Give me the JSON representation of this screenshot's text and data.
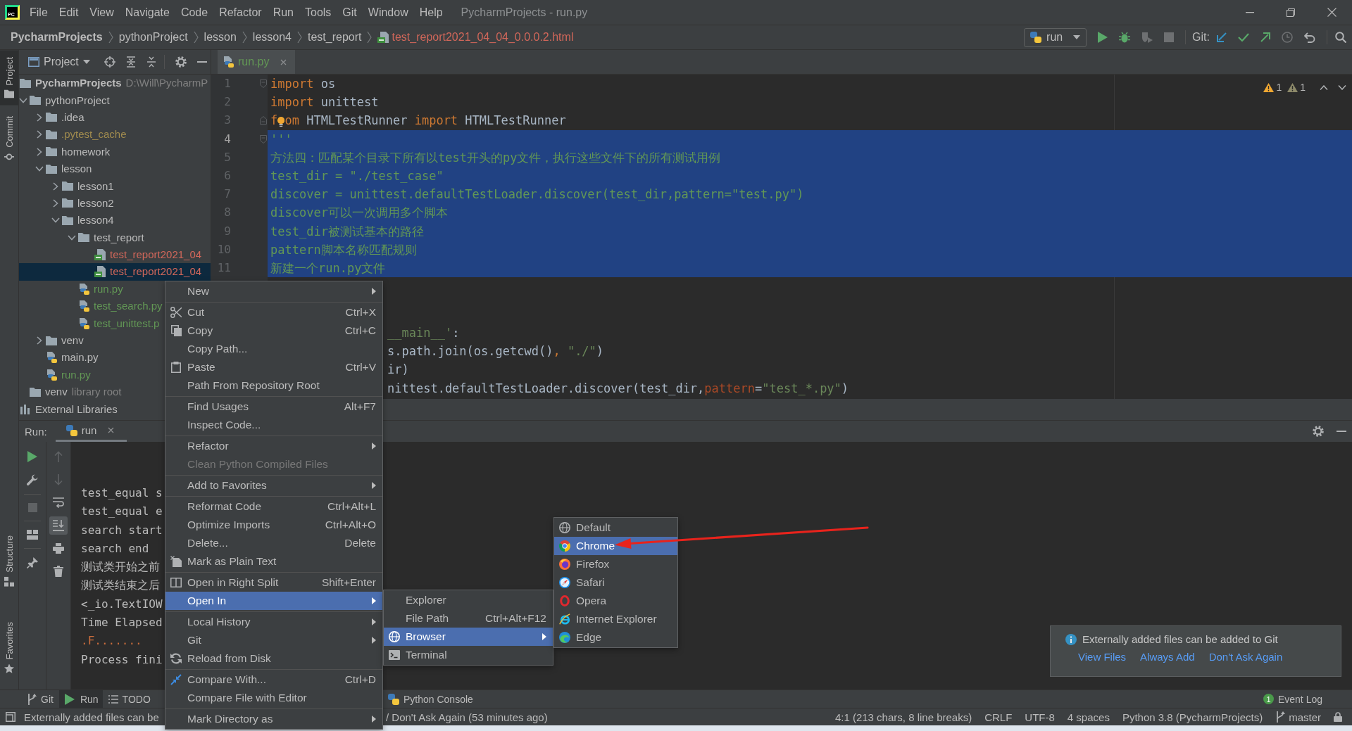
{
  "title_bar": {
    "logo": "PC",
    "menus": [
      "File",
      "Edit",
      "View",
      "Navigate",
      "Code",
      "Refactor",
      "Run",
      "Tools",
      "Git",
      "Window",
      "Help"
    ],
    "title": "PycharmProjects - run.py"
  },
  "navigation_bar": {
    "breadcrumbs": [
      {
        "label": "PycharmProjects",
        "kind": "project",
        "color": "#bbbbbb"
      },
      {
        "label": "pythonProject",
        "kind": "folder",
        "color": "#bbbbbb"
      },
      {
        "label": "lesson",
        "kind": "folder",
        "color": "#bbbbbb"
      },
      {
        "label": "lesson4",
        "kind": "folder",
        "color": "#bbbbbb"
      },
      {
        "label": "test_report",
        "kind": "folder",
        "color": "#bbbbbb"
      },
      {
        "label": "test_report2021_04_04_0.0.0.2.html",
        "kind": "html",
        "color": "#d1675a"
      }
    ],
    "run_configuration": "run",
    "git_label": "Git:"
  },
  "tool_strip": {
    "top": [
      {
        "label": "Project",
        "selected": true
      },
      {
        "label": "Commit",
        "selected": false
      }
    ],
    "bottom": [
      {
        "label": "Structure",
        "selected": false
      },
      {
        "label": "Favorites",
        "selected": false
      }
    ]
  },
  "project_panel": {
    "title": "Project",
    "tree": [
      {
        "label": "PycharmProjects",
        "kind": "project",
        "note": "D:\\Will\\PycharmP",
        "color": "#bbbbbb",
        "selected": false,
        "children": [
          {
            "label": "pythonProject",
            "kind": "folder",
            "expanded": true,
            "color": "#bbbbbb",
            "selected": false,
            "children": [
              {
                "label": ".idea",
                "kind": "folder",
                "expanded": false,
                "color": "#bbbbbb",
                "selected": false
              },
              {
                "label": ".pytest_cache",
                "kind": "folder",
                "expanded": false,
                "color": "#a08b4e",
                "selected": false
              },
              {
                "label": "homework",
                "kind": "folder",
                "expanded": false,
                "color": "#bbbbbb",
                "selected": false
              },
              {
                "label": "lesson",
                "kind": "folder",
                "expanded": true,
                "color": "#bbbbbb",
                "selected": false,
                "children": [
                  {
                    "label": "lesson1",
                    "kind": "folder",
                    "expanded": false,
                    "color": "#bbbbbb",
                    "selected": false
                  },
                  {
                    "label": "lesson2",
                    "kind": "folder",
                    "expanded": false,
                    "color": "#bbbbbb",
                    "selected": false
                  },
                  {
                    "label": "lesson4",
                    "kind": "folder",
                    "expanded": true,
                    "color": "#bbbbbb",
                    "selected": false,
                    "children": [
                      {
                        "label": "test_report",
                        "kind": "folder",
                        "expanded": true,
                        "color": "#bbbbbb",
                        "selected": false,
                        "children": [
                          {
                            "label": "test_report2021_04",
                            "kind": "html",
                            "color": "#d1675a",
                            "selected": false
                          },
                          {
                            "label": "test_report2021_04",
                            "kind": "html",
                            "color": "#d1675a",
                            "selected": true
                          }
                        ]
                      },
                      {
                        "label": "run.py",
                        "kind": "python",
                        "color": "#629755",
                        "selected": false
                      },
                      {
                        "label": "test_search.py",
                        "kind": "python",
                        "color": "#629755",
                        "selected": false
                      },
                      {
                        "label": "test_unittest.p",
                        "kind": "python",
                        "color": "#629755",
                        "selected": false
                      }
                    ]
                  }
                ]
              },
              {
                "label": "venv",
                "kind": "folder",
                "expanded": false,
                "color": "#bbbbbb",
                "selected": false
              },
              {
                "label": "main.py",
                "kind": "python",
                "color": "#bbbbbb",
                "selected": false
              },
              {
                "label": "run.py",
                "kind": "python",
                "color": "#629755",
                "selected": false
              }
            ]
          },
          {
            "label": "venv",
            "kind": "folder",
            "note": "library root",
            "color": "#bbbbbb",
            "selected": false
          }
        ]
      },
      {
        "label": "External Libraries",
        "kind": "library",
        "color": "#bbbbbb",
        "selected": false
      }
    ]
  },
  "editor": {
    "tabs": [
      {
        "label": "run.py",
        "color": "#629755",
        "selected": true
      }
    ],
    "inspections": [
      {
        "kind": "warning",
        "count": "1"
      },
      {
        "kind": "weak_warning",
        "count": "1"
      }
    ],
    "lines": [
      {
        "kind": "code",
        "number": "1",
        "current": false,
        "selected": false,
        "tokens": [
          {
            "kind": "keyword",
            "text": "import"
          },
          {
            "kind": "plain",
            "text": " os"
          }
        ]
      },
      {
        "kind": "code",
        "number": "2",
        "current": false,
        "selected": false,
        "tokens": [
          {
            "kind": "keyword",
            "text": "import"
          },
          {
            "kind": "plain",
            "text": " unittest"
          }
        ]
      },
      {
        "kind": "code",
        "number": "3",
        "current": false,
        "selected": false,
        "tokens": [
          {
            "kind": "keyword",
            "text": "f"
          },
          {
            "kind": "bulb"
          },
          {
            "kind": "keyword",
            "text": "om"
          },
          {
            "kind": "plain",
            "text": " HTMLTestRunner "
          },
          {
            "kind": "keyword",
            "text": "import"
          },
          {
            "kind": "plain",
            "text": " HTMLTestRunner"
          }
        ]
      },
      {
        "kind": "code",
        "number": "4",
        "current": true,
        "selected": true,
        "tokens": [
          {
            "kind": "docstring",
            "text": "'''"
          }
        ]
      },
      {
        "kind": "code",
        "number": "5",
        "current": false,
        "selected": true,
        "tokens": [
          {
            "kind": "docstring",
            "text": "方法四：匹配某个目录下所有以test开头的py文件，执行这些文件下的所有测试用例"
          }
        ]
      },
      {
        "kind": "code",
        "number": "6",
        "current": false,
        "selected": true,
        "tokens": [
          {
            "kind": "docstring",
            "text": "test_dir = \"./test_case\""
          }
        ]
      },
      {
        "kind": "code",
        "number": "7",
        "current": false,
        "selected": true,
        "tokens": [
          {
            "kind": "docstring",
            "text": "discover = unittest.defaultTestLoader.discover(test_dir,pattern=\"test.py\")"
          }
        ]
      },
      {
        "kind": "code",
        "number": "8",
        "current": false,
        "selected": true,
        "tokens": [
          {
            "kind": "docstring",
            "text": "discover可以一次调用多个脚本"
          }
        ]
      },
      {
        "kind": "code",
        "number": "9",
        "current": false,
        "selected": true,
        "tokens": [
          {
            "kind": "docstring",
            "text": "test_dir被测试基本的路径"
          }
        ]
      },
      {
        "kind": "code",
        "number": "10",
        "current": false,
        "selected": true,
        "tokens": [
          {
            "kind": "docstring",
            "text": "pattern脚本名称匹配规则"
          }
        ]
      },
      {
        "kind": "code",
        "number": "11",
        "current": false,
        "selected": true,
        "tokens": [
          {
            "kind": "docstring",
            "text": "新建一个run.py文件"
          }
        ]
      },
      {
        "kind": "covered",
        "tokens": [
          {
            "kind": "string",
            "text": "__main__'"
          },
          {
            "kind": "plain",
            "text": ":"
          }
        ]
      },
      {
        "kind": "covered",
        "tokens": [
          {
            "kind": "plain",
            "text": "s.path.join(os.getcwd()"
          },
          {
            "kind": "keyword",
            "text": ", "
          },
          {
            "kind": "string",
            "text": "\"./\""
          },
          {
            "kind": "plain",
            "text": ")"
          }
        ]
      },
      {
        "kind": "covered",
        "tokens": [
          {
            "kind": "plain",
            "text": "ir)"
          }
        ]
      },
      {
        "kind": "covered",
        "tokens": [
          {
            "kind": "plain",
            "text": "nittest.defaultTestLoader.discover(test_dir,"
          },
          {
            "kind": "kwarg",
            "text": "pattern"
          },
          {
            "kind": "plain",
            "text": "="
          },
          {
            "kind": "string",
            "text": "\"test_*.py\""
          },
          {
            "kind": "plain",
            "text": ")"
          }
        ]
      }
    ]
  },
  "run_panel": {
    "label": "Run:",
    "tabs": [
      {
        "label": "run",
        "selected": true
      }
    ],
    "scroll_to_end": true,
    "output": [
      {
        "kind": "stdout",
        "text": "test_equal s"
      },
      {
        "kind": "stdout",
        "text": "test_equal e"
      },
      {
        "kind": "stdout",
        "text": "search start"
      },
      {
        "kind": "stdout",
        "text": "search end"
      },
      {
        "kind": "stdout",
        "text": "测试类开始之前"
      },
      {
        "kind": "stdout",
        "text": "测试类结束之后"
      },
      {
        "kind": "stdout",
        "text": "<_io.TextIOW"
      },
      {
        "kind": "stdout",
        "text": "Time Elapsed"
      },
      {
        "kind": "stderr",
        "text": ".F......."
      },
      {
        "kind": "stdout",
        "text": "Process fini"
      }
    ]
  },
  "tool_window_bar": {
    "buttons": [
      {
        "label": "Git",
        "selected": false
      },
      {
        "label": "Run",
        "selected": true
      },
      {
        "label": "TODO",
        "selected": false
      },
      {
        "label": "Python Console",
        "selected": false
      }
    ],
    "event_log": {
      "label": "Event Log",
      "count": "1"
    }
  },
  "status_bar": {
    "message_start": "Externally added files can be",
    "message_end": "/ Don't Ask Again (53 minutes ago)",
    "caret": "4:1 (213 chars, 8 line breaks)",
    "line_separator": "CRLF",
    "encoding": "UTF-8",
    "indent": "4 spaces",
    "interpreter": "Python 3.8 (PycharmProjects)",
    "branch": "master"
  },
  "notification": {
    "message": "Externally added files can be added to Git",
    "actions": [
      "View Files",
      "Always Add",
      "Don't Ask Again"
    ]
  },
  "context_menu": {
    "items": [
      {
        "kind": "item",
        "label": "New",
        "submenu": true,
        "selected": false,
        "disabled": false
      },
      {
        "kind": "separator"
      },
      {
        "kind": "item",
        "label": "Cut",
        "shortcut": "Ctrl+X",
        "submenu": false,
        "selected": false,
        "disabled": false
      },
      {
        "kind": "item",
        "label": "Copy",
        "shortcut": "Ctrl+C",
        "submenu": false,
        "selected": false,
        "disabled": false
      },
      {
        "kind": "item",
        "label": "Copy Path...",
        "submenu": false,
        "selected": false,
        "disabled": false
      },
      {
        "kind": "item",
        "label": "Paste",
        "shortcut": "Ctrl+V",
        "submenu": false,
        "selected": false,
        "disabled": false
      },
      {
        "kind": "item",
        "label": "Path From Repository Root",
        "submenu": false,
        "selected": false,
        "disabled": false
      },
      {
        "kind": "separator"
      },
      {
        "kind": "item",
        "label": "Find Usages",
        "shortcut": "Alt+F7",
        "submenu": false,
        "selected": false,
        "disabled": false
      },
      {
        "kind": "item",
        "label": "Inspect Code...",
        "submenu": false,
        "selected": false,
        "disabled": false
      },
      {
        "kind": "separator"
      },
      {
        "kind": "item",
        "label": "Refactor",
        "submenu": true,
        "selected": false,
        "disabled": false
      },
      {
        "kind": "item",
        "label": "Clean Python Compiled Files",
        "submenu": false,
        "selected": false,
        "disabled": true
      },
      {
        "kind": "separator"
      },
      {
        "kind": "item",
        "label": "Add to Favorites",
        "submenu": true,
        "selected": false,
        "disabled": false
      },
      {
        "kind": "separator"
      },
      {
        "kind": "item",
        "label": "Reformat Code",
        "shortcut": "Ctrl+Alt+L",
        "submenu": false,
        "selected": false,
        "disabled": false
      },
      {
        "kind": "item",
        "label": "Optimize Imports",
        "shortcut": "Ctrl+Alt+O",
        "submenu": false,
        "selected": false,
        "disabled": false
      },
      {
        "kind": "item",
        "label": "Delete...",
        "shortcut": "Delete",
        "submenu": false,
        "selected": false,
        "disabled": false
      },
      {
        "kind": "item",
        "label": "Mark as Plain Text",
        "submenu": false,
        "selected": false,
        "disabled": false
      },
      {
        "kind": "separator"
      },
      {
        "kind": "item",
        "label": "Open in Right Split",
        "shortcut": "Shift+Enter",
        "submenu": false,
        "selected": false,
        "disabled": false
      },
      {
        "kind": "item",
        "label": "Open In",
        "submenu": true,
        "selected": true,
        "disabled": false
      },
      {
        "kind": "separator"
      },
      {
        "kind": "item",
        "label": "Local History",
        "submenu": true,
        "selected": false,
        "disabled": false
      },
      {
        "kind": "item",
        "label": "Git",
        "submenu": true,
        "selected": false,
        "disabled": false
      },
      {
        "kind": "item",
        "label": "Reload from Disk",
        "submenu": false,
        "selected": false,
        "disabled": false
      },
      {
        "kind": "separator"
      },
      {
        "kind": "item",
        "label": "Compare With...",
        "shortcut": "Ctrl+D",
        "submenu": false,
        "selected": false,
        "disabled": false
      },
      {
        "kind": "item",
        "label": "Compare File with Editor",
        "submenu": false,
        "selected": false,
        "disabled": false
      },
      {
        "kind": "separator"
      },
      {
        "kind": "item",
        "label": "Mark Directory as",
        "submenu": true,
        "selected": false,
        "disabled": false
      }
    ]
  },
  "open_in_menu": {
    "items": [
      {
        "kind": "item",
        "label": "Explorer",
        "submenu": false,
        "selected": false
      },
      {
        "kind": "item",
        "label": "File Path",
        "shortcut": "Ctrl+Alt+F12",
        "submenu": false,
        "selected": false
      },
      {
        "kind": "item",
        "label": "Browser",
        "submenu": true,
        "selected": true
      },
      {
        "kind": "item",
        "label": "Terminal",
        "submenu": false,
        "selected": false
      }
    ]
  },
  "browser_menu": {
    "items": [
      {
        "kind": "item",
        "label": "Default",
        "selected": false
      },
      {
        "kind": "item",
        "label": "Chrome",
        "selected": true
      },
      {
        "kind": "item",
        "label": "Firefox",
        "selected": false
      },
      {
        "kind": "item",
        "label": "Safari",
        "selected": false
      },
      {
        "kind": "item",
        "label": "Opera",
        "selected": false
      },
      {
        "kind": "item",
        "label": "Internet Explorer",
        "selected": false
      },
      {
        "kind": "item",
        "label": "Edge",
        "selected": false
      }
    ]
  }
}
